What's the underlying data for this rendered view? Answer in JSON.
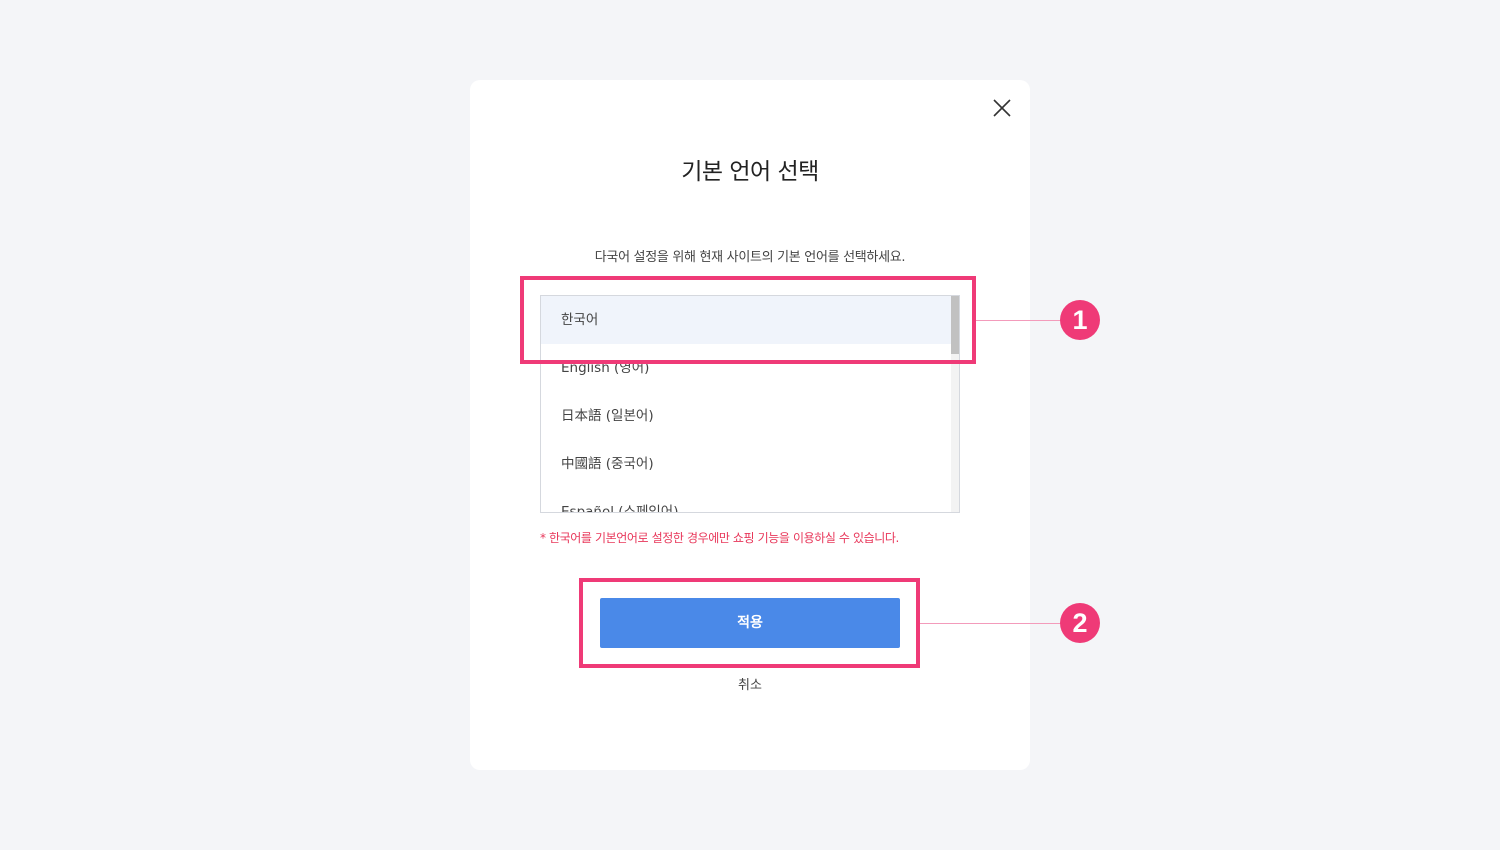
{
  "dialog": {
    "title": "기본 언어 선택",
    "description": "다국어 설정을 위해 현재 사이트의 기본 언어를 선택하세요.",
    "languages": [
      {
        "label": "한국어",
        "selected": true
      },
      {
        "label": "English (영어)",
        "selected": false
      },
      {
        "label": "日本語 (일본어)",
        "selected": false
      },
      {
        "label": "中國語 (중국어)",
        "selected": false
      },
      {
        "label": "Español (스페인어)",
        "selected": false
      }
    ],
    "notice": "* 한국어를 기본언어로 설정한 경우에만 쇼핑 기능을 이용하실 수 있습니다.",
    "apply_label": "적용",
    "cancel_label": "취소",
    "close_icon": "close-icon"
  },
  "annotations": {
    "markers": [
      "1",
      "2"
    ]
  },
  "colors": {
    "background": "#f4f5f8",
    "accent": "#4a89e8",
    "highlight": "#ef3a77",
    "notice": "#e8375a",
    "selected_row": "#f0f4fb"
  }
}
